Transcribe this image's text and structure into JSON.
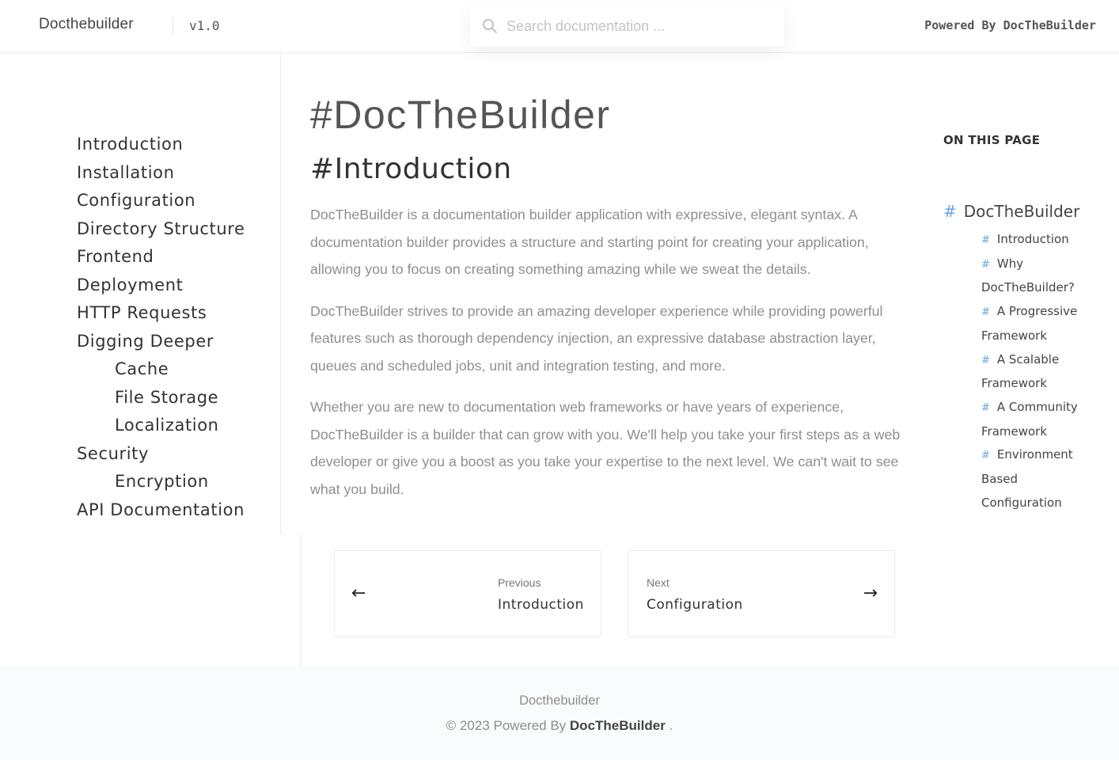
{
  "header": {
    "brand": "Docthebuilder",
    "version": "v1.0",
    "search_placeholder": "Search documentation ...",
    "powered": "Powered By DocTheBuilder"
  },
  "sidebar": {
    "items": [
      {
        "label": "Introduction",
        "level": 1
      },
      {
        "label": "Installation",
        "level": 1
      },
      {
        "label": "Configuration",
        "level": 1
      },
      {
        "label": "Directory Structure",
        "level": 1
      },
      {
        "label": "Frontend",
        "level": 1
      },
      {
        "label": "Deployment",
        "level": 1
      },
      {
        "label": "HTTP Requests",
        "level": 1
      },
      {
        "label": "Digging Deeper",
        "level": 1
      },
      {
        "label": "Cache",
        "level": 2
      },
      {
        "label": "File Storage",
        "level": 2
      },
      {
        "label": "Localization",
        "level": 2
      },
      {
        "label": "Security",
        "level": 1
      },
      {
        "label": "Encryption",
        "level": 2
      },
      {
        "label": "API Documentation",
        "level": 1
      }
    ]
  },
  "main": {
    "title": "#DocTheBuilder",
    "section_title": "#Introduction",
    "paragraphs": [
      "DocTheBuilder is a documentation builder application with expressive, elegant syntax. A documentation builder provides a structure and starting point for creating your application, allowing you to focus on creating something amazing while we sweat the details.",
      "DocTheBuilder strives to provide an amazing developer experience while providing powerful features such as thorough dependency injection, an expressive database abstraction layer, queues and scheduled jobs, unit and integration testing, and more.",
      "Whether you are new to documentation web frameworks or have years of experience, DocTheBuilder is a builder that can grow with you. We'll help you take your first steps as a web developer or give you a boost as you take your expertise to the next level. We can't wait to see what you build."
    ]
  },
  "toc": {
    "heading": "ON THIS PAGE",
    "hash": "#",
    "root": "DocTheBuilder",
    "items": [
      "Introduction",
      "Why DocTheBuilder?",
      "A Progressive Framework",
      "A Scalable Framework",
      "A Community Framework",
      "Environment Based Configuration"
    ]
  },
  "pagination": {
    "prev": {
      "caption": "Previous",
      "title": "Introduction",
      "arrow": "←"
    },
    "next": {
      "caption": "Next",
      "title": "Configuration",
      "arrow": "→"
    }
  },
  "footer": {
    "brand": "Docthebuilder",
    "copy_prefix": "© 2023 Powered By",
    "copy_brand": "DocTheBuilder",
    "copy_suffix": "."
  },
  "colors": {
    "accent_hash": "#6aa5d8",
    "body_text": "#8f8f8f",
    "footer_bg": "#fafbfc"
  }
}
